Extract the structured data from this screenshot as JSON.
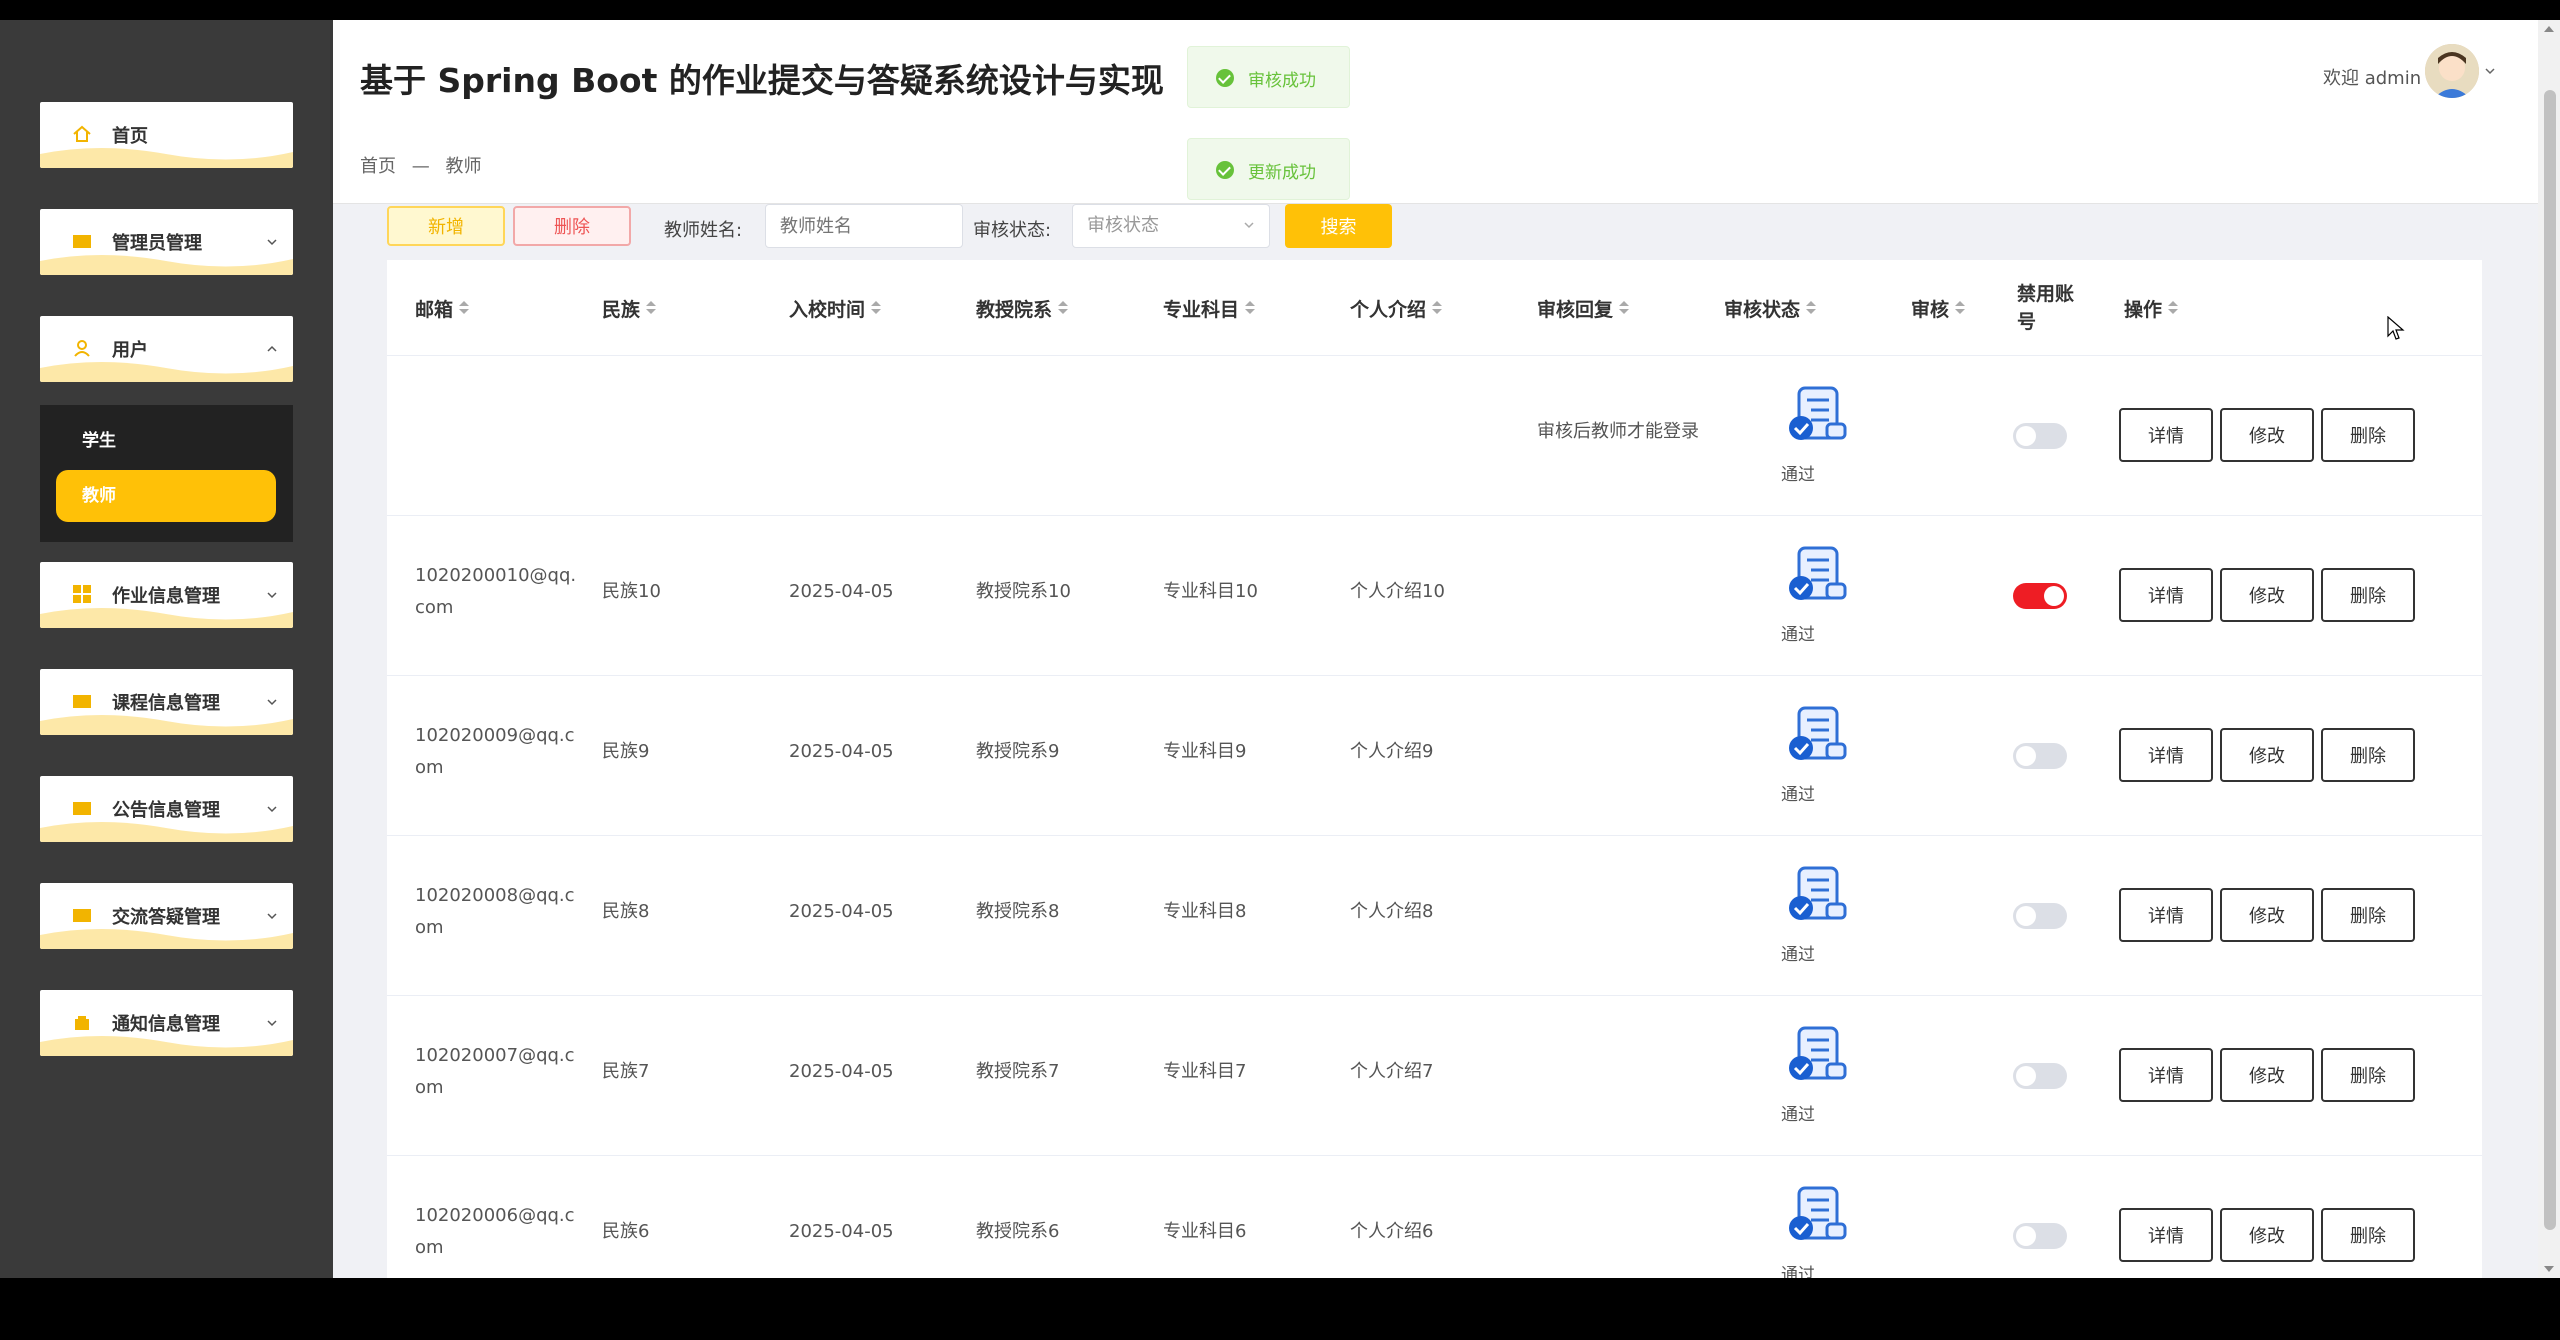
{
  "app": {
    "title": "基于 Spring Boot 的作业提交与答疑系统设计与实现"
  },
  "header": {
    "welcome": "欢迎 admin"
  },
  "breadcrumb": {
    "home": "首页",
    "sep": "—",
    "current": "教师"
  },
  "toasts": [
    {
      "message": "审核成功"
    },
    {
      "message": "更新成功"
    }
  ],
  "sidebar": {
    "items": [
      {
        "label": "首页",
        "icon": "home-icon"
      },
      {
        "label": "管理员管理",
        "icon": "folder-icon"
      },
      {
        "label": "用户",
        "icon": "user-icon"
      },
      {
        "label": "作业信息管理",
        "icon": "grid-icon"
      },
      {
        "label": "课程信息管理",
        "icon": "folder-icon"
      },
      {
        "label": "公告信息管理",
        "icon": "folder-icon"
      },
      {
        "label": "交流答疑管理",
        "icon": "folder-icon"
      },
      {
        "label": "通知信息管理",
        "icon": "bag-icon"
      }
    ],
    "submenu": [
      {
        "label": "学生"
      },
      {
        "label": "教师",
        "active": true
      }
    ]
  },
  "toolbar": {
    "add_label": "新增",
    "delete_label": "删除",
    "name_label": "教师姓名:",
    "name_placeholder": "教师姓名",
    "status_label": "审核状态:",
    "status_placeholder": "审核状态",
    "search_label": "搜索"
  },
  "table": {
    "columns": [
      "邮箱",
      "民族",
      "入校时间",
      "教授院系",
      "专业科目",
      "个人介绍",
      "审核回复",
      "审核状态",
      "审核",
      "禁用账号",
      "操作"
    ],
    "rows": [
      {
        "email": "",
        "ethnicity": "",
        "date": "",
        "dept": "",
        "subject": "",
        "intro": "",
        "reply": "审核后教师才能登录",
        "status": "通过",
        "disabled": false
      },
      {
        "email": "1020200010@qq.com",
        "ethnicity": "民族10",
        "date": "2025-04-05",
        "dept": "教授院系10",
        "subject": "专业科目10",
        "intro": "个人介绍10",
        "reply": "",
        "status": "通过",
        "disabled": true
      },
      {
        "email": "102020009@qq.com",
        "ethnicity": "民族9",
        "date": "2025-04-05",
        "dept": "教授院系9",
        "subject": "专业科目9",
        "intro": "个人介绍9",
        "reply": "",
        "status": "通过",
        "disabled": false
      },
      {
        "email": "102020008@qq.com",
        "ethnicity": "民族8",
        "date": "2025-04-05",
        "dept": "教授院系8",
        "subject": "专业科目8",
        "intro": "个人介绍8",
        "reply": "",
        "status": "通过",
        "disabled": false
      },
      {
        "email": "102020007@qq.com",
        "ethnicity": "民族7",
        "date": "2025-04-05",
        "dept": "教授院系7",
        "subject": "专业科目7",
        "intro": "个人介绍7",
        "reply": "",
        "status": "通过",
        "disabled": false
      },
      {
        "email": "102020006@qq.com",
        "ethnicity": "民族6",
        "date": "2025-04-05",
        "dept": "教授院系6",
        "subject": "专业科目6",
        "intro": "个人介绍6",
        "reply": "",
        "status": "通过",
        "disabled": false
      }
    ],
    "actions": {
      "detail": "详情",
      "edit": "修改",
      "delete": "删除"
    }
  },
  "colors": {
    "accent": "#ffc107",
    "sidebar_bg": "#3a3a3a",
    "toggle_on": "#ee1d24",
    "success": "#67c23a"
  }
}
